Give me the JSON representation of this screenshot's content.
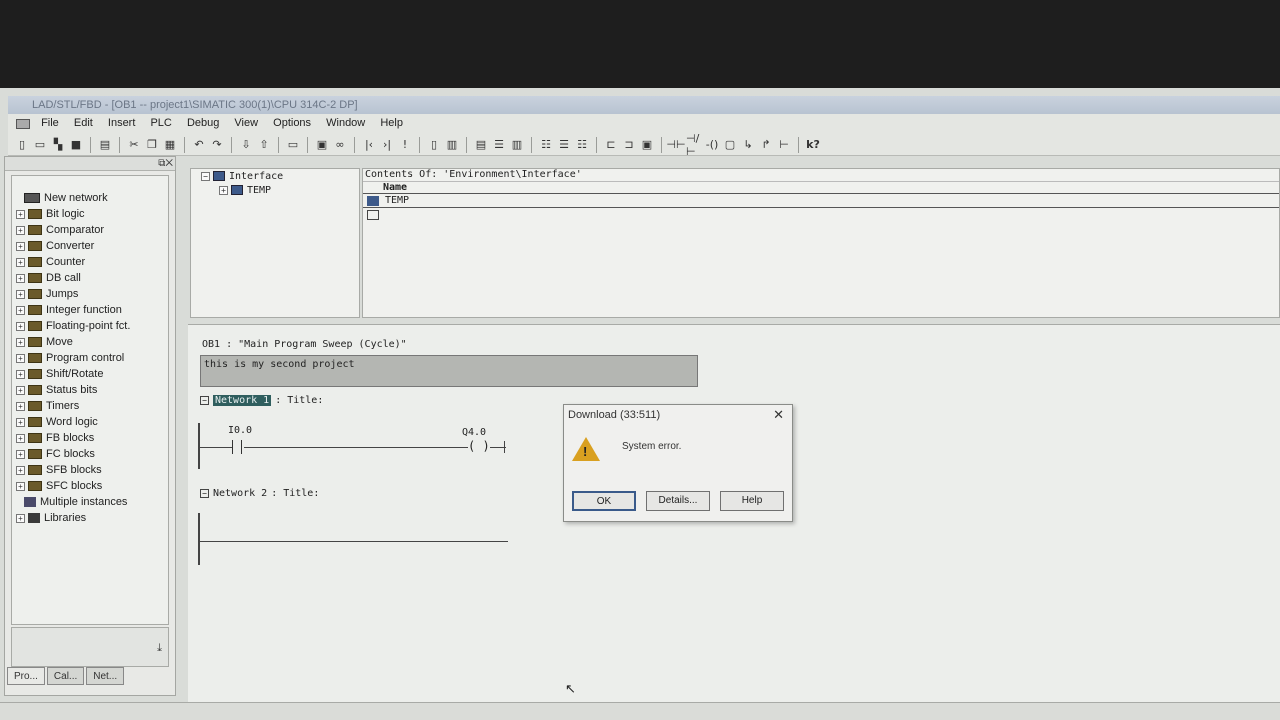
{
  "window": {
    "title": "LAD/STL/FBD - [OB1 -- project1\\SIMATIC 300(1)\\CPU 314C-2 DP]"
  },
  "menu": [
    "File",
    "Edit",
    "Insert",
    "PLC",
    "Debug",
    "View",
    "Options",
    "Window",
    "Help"
  ],
  "catalog": {
    "items": [
      {
        "label": "New network",
        "icon": "network-icon",
        "expand": false
      },
      {
        "label": "Bit logic",
        "icon": "folder-icon",
        "expand": true
      },
      {
        "label": "Comparator",
        "icon": "folder-icon",
        "expand": true
      },
      {
        "label": "Converter",
        "icon": "folder-icon",
        "expand": true
      },
      {
        "label": "Counter",
        "icon": "folder-icon",
        "expand": true
      },
      {
        "label": "DB call",
        "icon": "folder-icon",
        "expand": true
      },
      {
        "label": "Jumps",
        "icon": "folder-icon",
        "expand": true
      },
      {
        "label": "Integer function",
        "icon": "folder-icon",
        "expand": true
      },
      {
        "label": "Floating-point fct.",
        "icon": "folder-icon",
        "expand": true
      },
      {
        "label": "Move",
        "icon": "folder-icon",
        "expand": true
      },
      {
        "label": "Program control",
        "icon": "folder-icon",
        "expand": true
      },
      {
        "label": "Shift/Rotate",
        "icon": "folder-icon",
        "expand": true
      },
      {
        "label": "Status bits",
        "icon": "folder-icon",
        "expand": true
      },
      {
        "label": "Timers",
        "icon": "folder-icon",
        "expand": true
      },
      {
        "label": "Word logic",
        "icon": "folder-icon",
        "expand": true
      },
      {
        "label": "FB blocks",
        "icon": "folder-icon",
        "expand": true
      },
      {
        "label": "FC blocks",
        "icon": "folder-icon",
        "expand": true
      },
      {
        "label": "SFB blocks",
        "icon": "folder-icon",
        "expand": true
      },
      {
        "label": "SFC blocks",
        "icon": "folder-icon",
        "expand": true
      },
      {
        "label": "Multiple instances",
        "icon": "multi-instance-icon",
        "expand": false
      },
      {
        "label": "Libraries",
        "icon": "library-icon",
        "expand": true
      }
    ],
    "tabs": [
      "Pro...",
      "Cal...",
      "Net..."
    ]
  },
  "interface": {
    "root": "Interface",
    "child": "TEMP",
    "contents_header": "Contents Of: 'Environment\\Interface'",
    "column": "Name",
    "rows": [
      "TEMP",
      ""
    ]
  },
  "editor": {
    "block_title": "OB1 :  \"Main Program Sweep (Cycle)\"",
    "comment": "this is my second project",
    "network1": {
      "label": "Network 1",
      "title": ": Title:",
      "contact": "I0.0",
      "coil": "Q4.0"
    },
    "network2": {
      "label": "Network 2",
      "title": ": Title:"
    }
  },
  "dialog": {
    "title": "Download (33:511)",
    "message": "System error.",
    "buttons": {
      "ok": "OK",
      "details": "Details...",
      "help": "Help"
    }
  }
}
